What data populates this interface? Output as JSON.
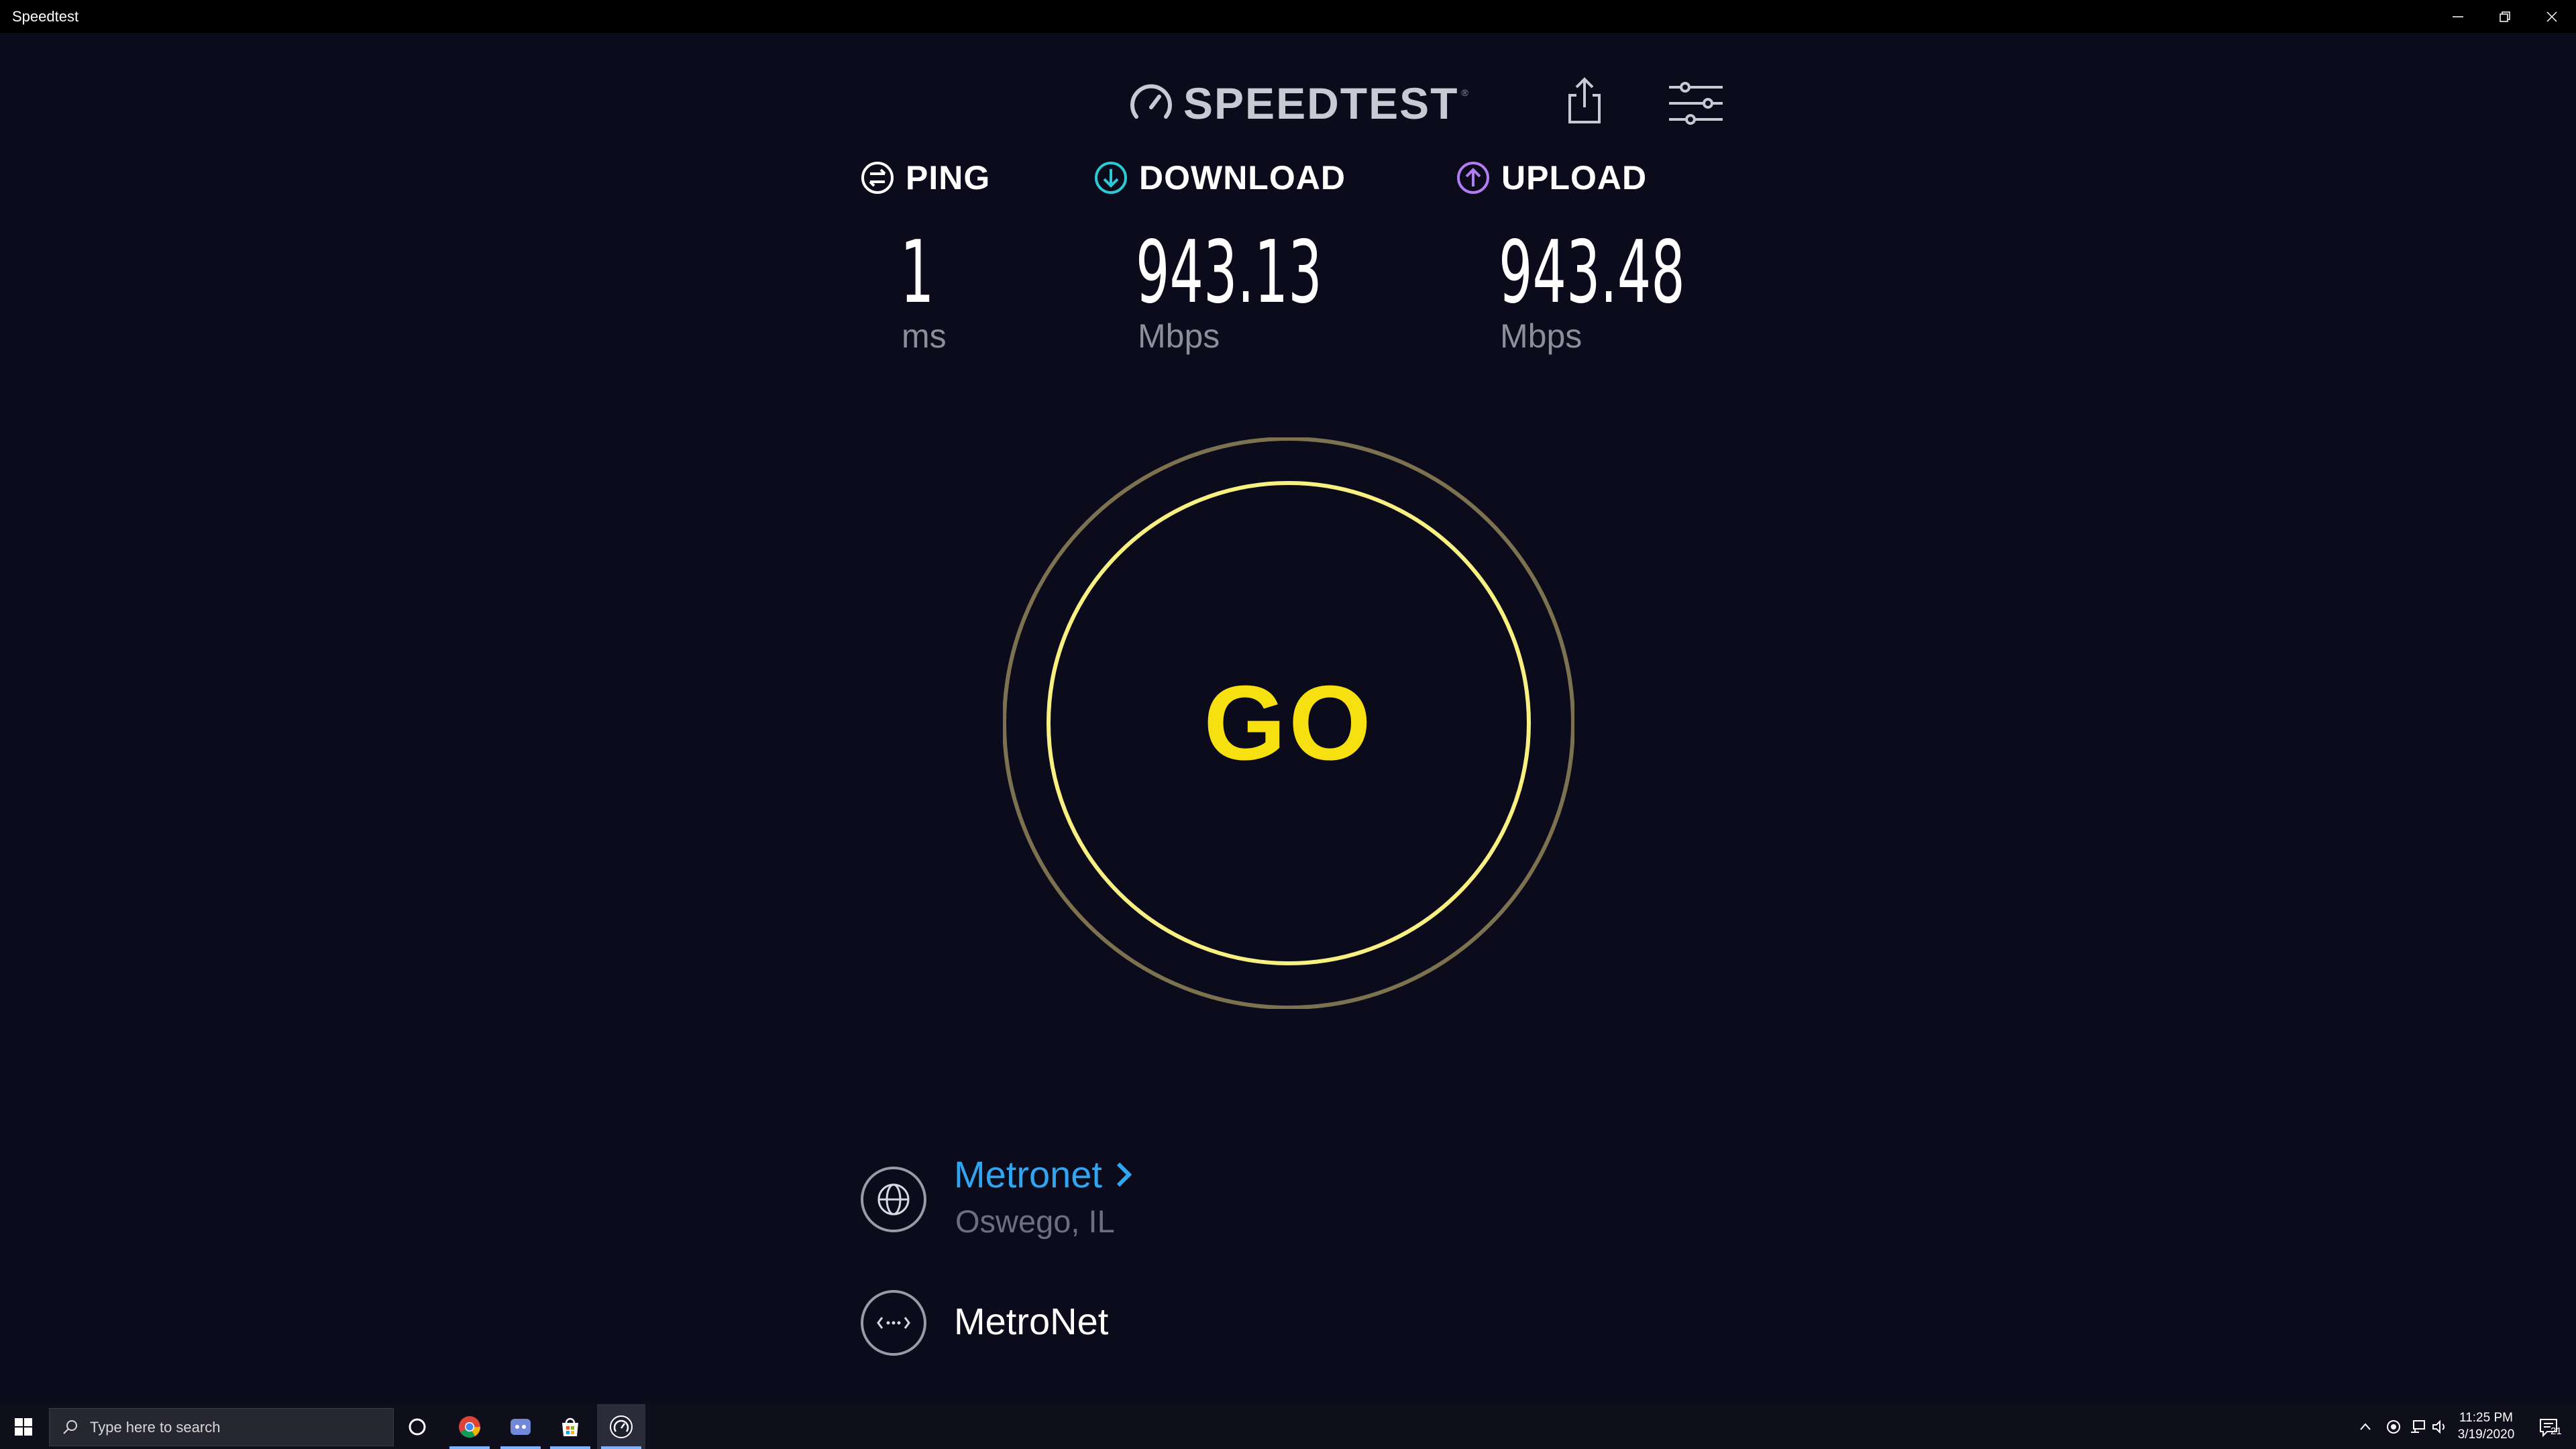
{
  "window": {
    "title": "Speedtest"
  },
  "header": {
    "logo_text": "SPEEDTEST",
    "logo_mark": "®"
  },
  "metrics": {
    "ping": {
      "label": "PING",
      "value": "1",
      "unit": "ms"
    },
    "download": {
      "label": "DOWNLOAD",
      "value": "943.13",
      "unit": "Mbps"
    },
    "upload": {
      "label": "UPLOAD",
      "value": "943.48",
      "unit": "Mbps"
    }
  },
  "go_button": {
    "label": "GO"
  },
  "server": {
    "name": "Metronet",
    "location": "Oswego, IL"
  },
  "isp": {
    "name": "MetroNet"
  },
  "taskbar": {
    "search_placeholder": "Type here to search",
    "time": "11:25 PM",
    "date": "3/19/2020",
    "notification_count": "21"
  },
  "icons": {
    "ping": "ping-icon",
    "download": "download-arrow-icon",
    "upload": "upload-arrow-icon",
    "share": "share-icon",
    "settings": "settings-sliders-icon",
    "server": "globe-icon",
    "isp": "connection-icon"
  },
  "colors": {
    "background": "#0b0b1c",
    "ping_accent": "#ffffff",
    "download_accent": "#2ec9d6",
    "upload_accent": "#b27cf2",
    "go_yellow": "#f6e010",
    "server_link": "#2ea6f2",
    "muted_text": "#8d8d9c"
  }
}
